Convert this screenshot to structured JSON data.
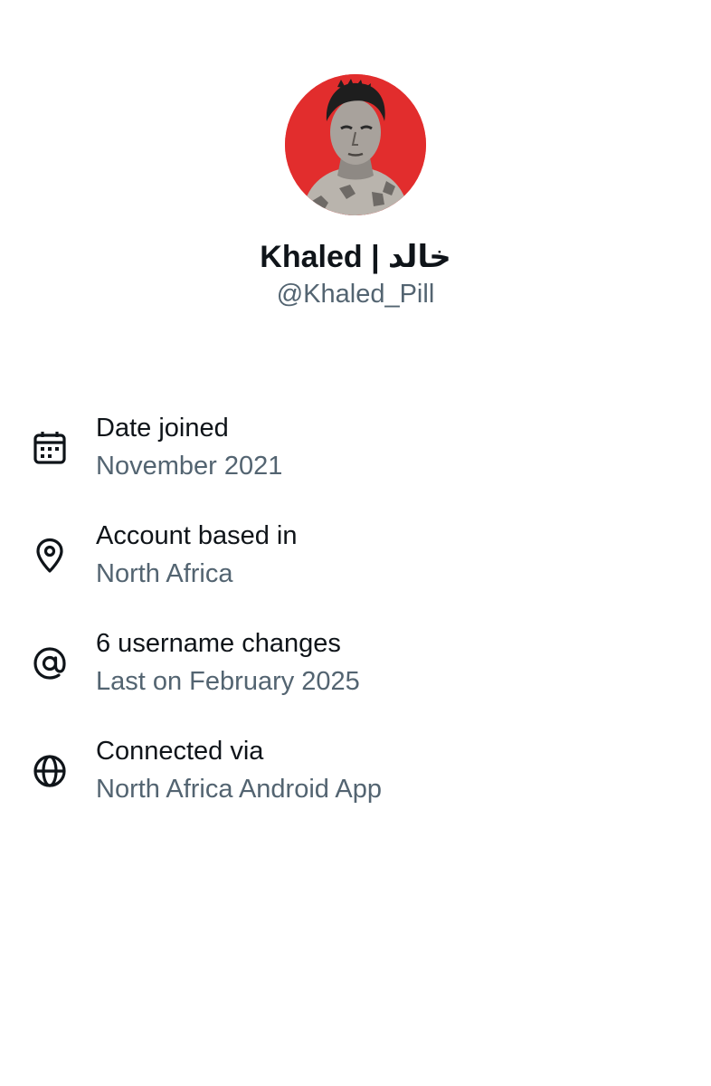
{
  "profile": {
    "display_name": "Khaled | خالد",
    "handle": "@Khaled_Pill",
    "avatar_background": "#e22d2d"
  },
  "info": [
    {
      "icon": "calendar-icon",
      "title": "Date joined",
      "value": "November 2021"
    },
    {
      "icon": "location-pin-icon",
      "title": "Account based in",
      "value": "North Africa"
    },
    {
      "icon": "at-sign-icon",
      "title": "6 username changes",
      "value": "Last on February 2025"
    },
    {
      "icon": "globe-icon",
      "title": "Connected via",
      "value": "North Africa Android App"
    }
  ],
  "colors": {
    "primary_text": "#0f1419",
    "secondary_text": "#536471"
  }
}
